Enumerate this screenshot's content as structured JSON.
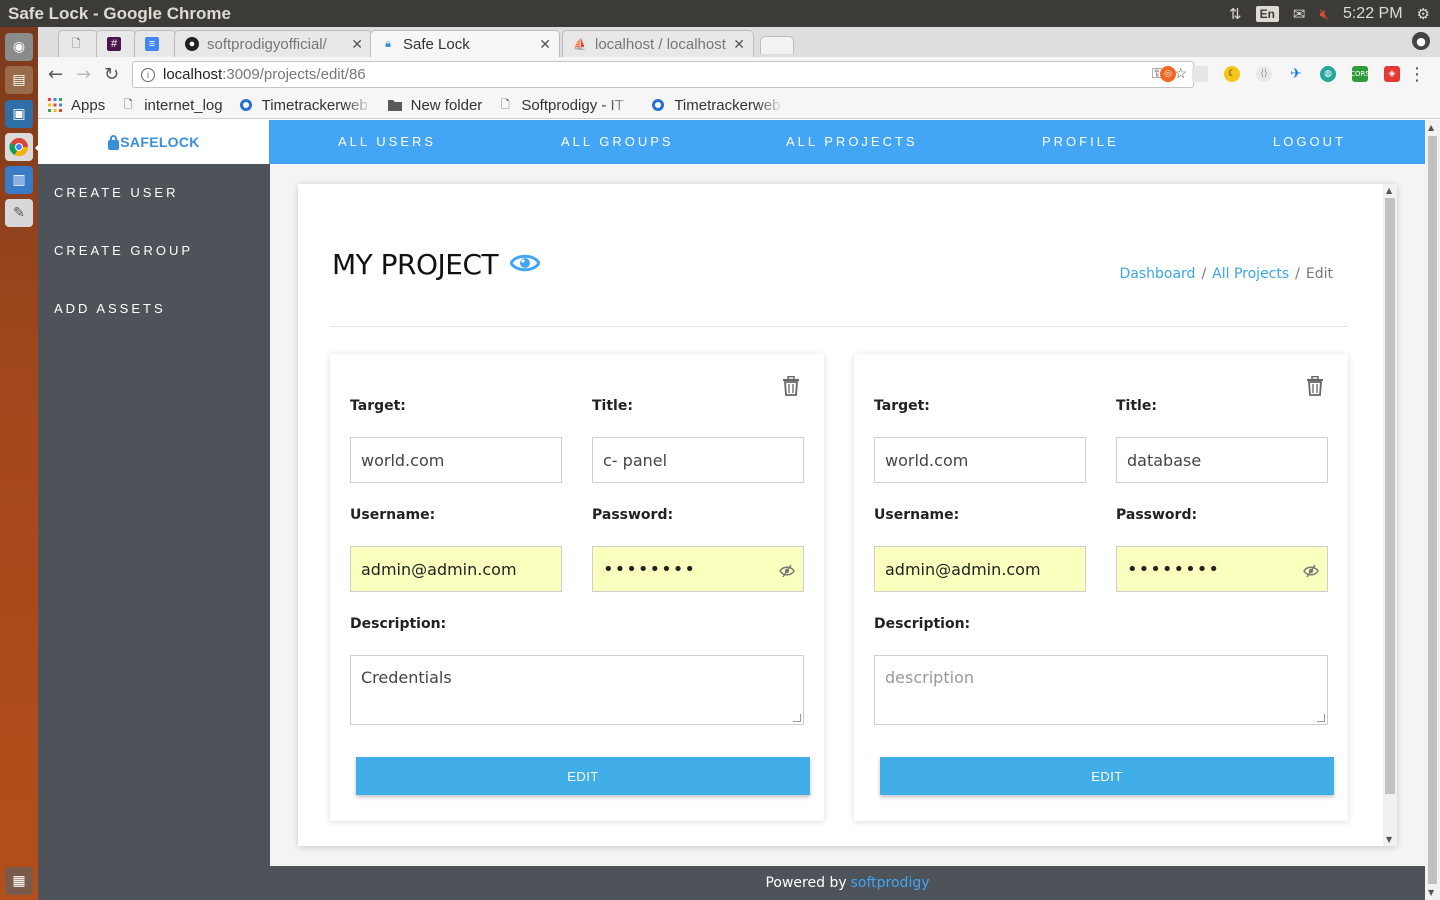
{
  "os": {
    "window_title": "Safe Lock - Google Chrome",
    "lang": "En",
    "clock": "5:22 PM"
  },
  "browser": {
    "tabs": [
      {
        "label": ""
      },
      {
        "label": ""
      },
      {
        "label": ""
      },
      {
        "label": "softprodigyofficial/"
      },
      {
        "label": "Safe Lock"
      },
      {
        "label": "localhost / localhost"
      }
    ],
    "url_host": "localhost",
    "url_path": ":3009/projects/edit/86",
    "bookmarks": [
      {
        "label": "Apps",
        "icon": "apps-grid-icon"
      },
      {
        "label": "internet_log",
        "icon": "page-icon"
      },
      {
        "label": "Timetrackerweb",
        "icon": "timetracker-icon"
      },
      {
        "label": "New folder",
        "icon": "folder-icon"
      },
      {
        "label": "Softprodigy - IT",
        "icon": "page-icon"
      },
      {
        "label": "Timetrackerweb",
        "icon": "timetracker-icon"
      }
    ]
  },
  "app": {
    "brand": "SAFELOCK",
    "sidebar": [
      {
        "label": "CREATE USER"
      },
      {
        "label": "CREATE GROUP"
      },
      {
        "label": "ADD ASSETS"
      }
    ],
    "topnav": [
      {
        "label": "ALL USERS"
      },
      {
        "label": "ALL GROUPS"
      },
      {
        "label": "ALL PROJECTS"
      },
      {
        "label": "PROFILE"
      },
      {
        "label": "LOGOUT"
      }
    ],
    "page_title": "MY PROJECT",
    "breadcrumb": {
      "dashboard": "Dashboard",
      "projects": "All Projects",
      "current": "Edit",
      "sep": "/"
    },
    "labels": {
      "target": "Target:",
      "title": "Title:",
      "username": "Username:",
      "password": "Password:",
      "description": "Description:",
      "edit": "EDIT"
    },
    "assets": [
      {
        "target": "world.com",
        "title": "c- panel",
        "username": "admin@admin.com",
        "password_masked": "••••••••",
        "description": "Credentials",
        "description_is_placeholder": false
      },
      {
        "target": "world.com",
        "title": "database",
        "username": "admin@admin.com",
        "password_masked": "••••••••",
        "description": "description",
        "description_is_placeholder": true
      }
    ],
    "footer": {
      "prefix": "Powered by",
      "link": "softprodigy"
    }
  },
  "colors": {
    "accent": "#42a5f5",
    "sidebar": "#4d5358",
    "autofill": "#faffbd",
    "button": "#42aee8"
  }
}
